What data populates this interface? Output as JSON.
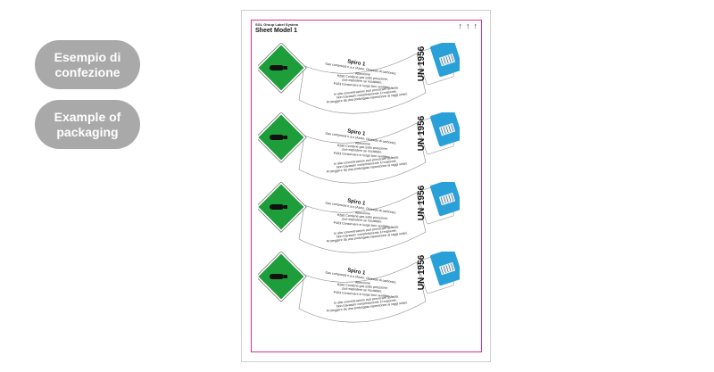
{
  "buttons": {
    "italian": "Esempio di\nconfezione",
    "english": "Example of\npackaging"
  },
  "sheet": {
    "system_label": "SGL Group Label System",
    "model": "Sheet Model 1",
    "arrow_glyph": "↑"
  },
  "label": {
    "product": "Spiro 1",
    "composition": "Gas compressi n.a.s (Azoto, Diossido di carbonio)",
    "warnings": "Attenzione\nH280 Contiene gas sotto pressione;\npuò esplodere se riscaldato.\nP403 Conservare in luogo ben ventilato.",
    "safety": "In alta concentrazione può provocare asfissia.\nNon travasare completamente il recipiente.\nProteggere da una prolungata esposizione ai raggi solari.",
    "un_number": "UN 1956"
  },
  "colors": {
    "pill": "#a9a9a9",
    "frame": "#e3308a",
    "hazard_green": "#1e9e3a",
    "info_blue": "#2aa0d8"
  }
}
